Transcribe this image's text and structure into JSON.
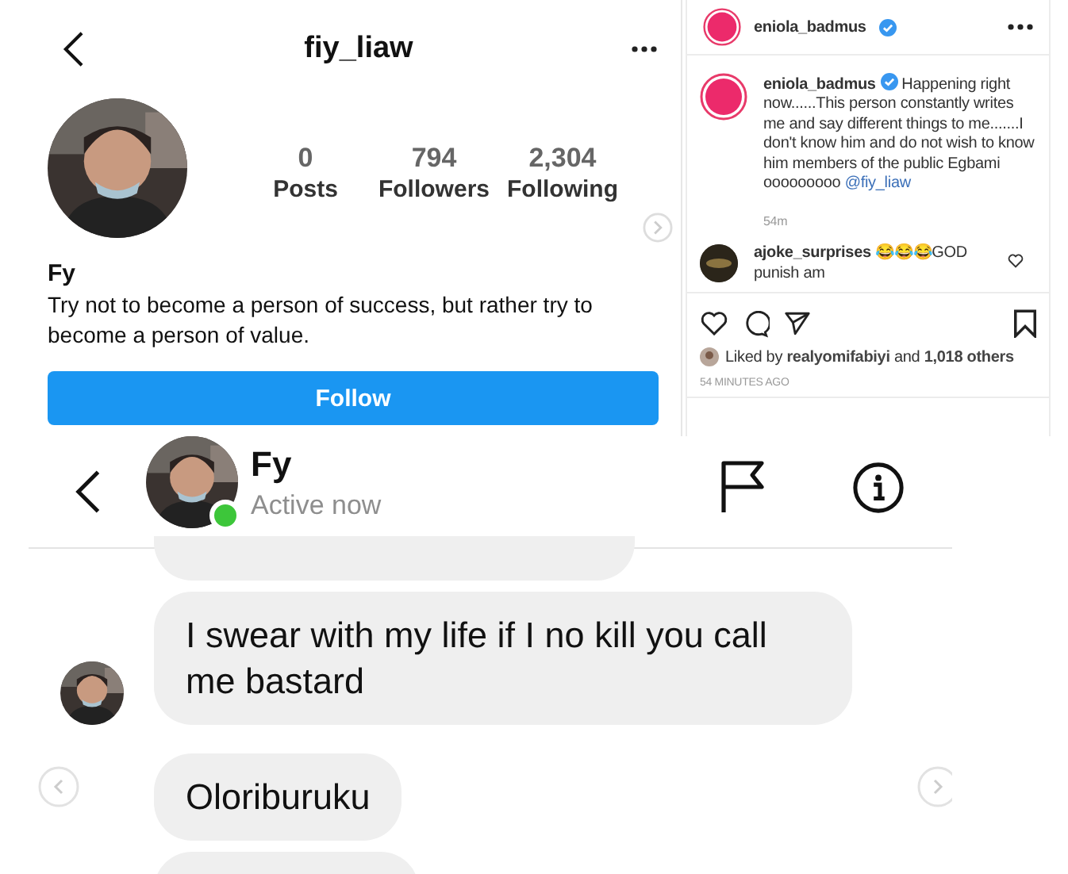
{
  "profile": {
    "username": "fiy_liaw",
    "stats": [
      {
        "value": "0",
        "label": "Posts"
      },
      {
        "value": "794",
        "label": "Followers"
      },
      {
        "value": "2,304",
        "label": "Following"
      }
    ],
    "name": "Fy",
    "bio": "Try not to become a person of success, but rather try to become a person of value.",
    "follow_button": "Follow"
  },
  "post": {
    "username": "eniola_badmus",
    "caption": {
      "username": "eniola_badmus",
      "text": "Happening right now......This person constantly writes me and say different things to me.......I don't know him and do not wish to know him members of the public Egbami ooooooooo",
      "mention": "@fiy_liaw",
      "time": "54m"
    },
    "comment": {
      "username": "ajoke_surprises",
      "text": "😂😂😂GOD punish am"
    },
    "likes": "Liked by **realyomifabiyi** and **1,018 others**",
    "timestamp": "54 MINUTES AGO"
  },
  "chat": {
    "contact": {
      "name": "Fy",
      "status": "Active now",
      "online": true
    },
    "messages": [
      {
        "kind": "cut",
        "show_avatar": false
      },
      {
        "kind": "text",
        "text": "I swear with my life if I no kill you call me bastard",
        "show_avatar": true
      },
      {
        "kind": "text",
        "text": "Oloriburuku",
        "show_avatar": false
      },
      {
        "kind": "cut",
        "show_avatar": false
      }
    ]
  }
}
